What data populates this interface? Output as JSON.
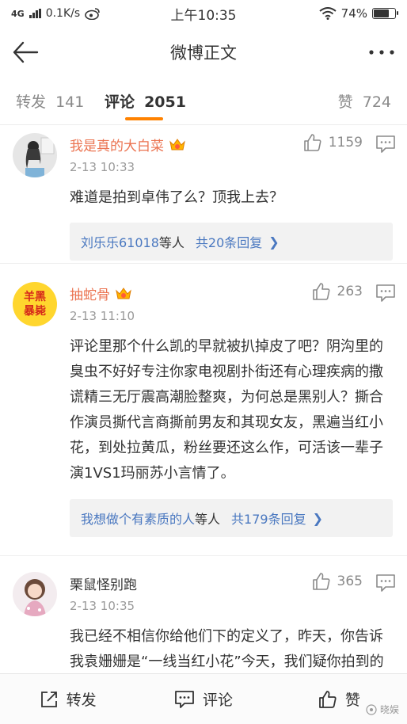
{
  "status_bar": {
    "network": "4G",
    "speed": "0.1K/s",
    "time": "上午10:35",
    "battery": "74%",
    "battery_level": 0.74
  },
  "nav": {
    "title": "微博正文"
  },
  "tabs": {
    "repost_label": "转发",
    "repost_count": "141",
    "comments_label": "评论",
    "comments_count": "2051",
    "likes_label": "赞",
    "likes_count": "724"
  },
  "comments": [
    {
      "username": "我是真的大白菜",
      "time": "2-13 10:33",
      "likes": "1159",
      "text": "难道是拍到卓伟了么？顶我上去？",
      "reply_who": "刘乐乐61018",
      "reply_mid": "等人",
      "reply_total": "共20条回复"
    },
    {
      "username": "抽蛇骨",
      "avatar_text_1": "羊黑",
      "avatar_text_2": "暴毙",
      "time": "2-13 11:10",
      "likes": "263",
      "text": "评论里那个什么凯的早就被扒掉皮了吧？阴沟里的臭虫不好好专注你家电视剧扑街还有心理疾病的撒谎精三无厅震高潮脸整爽，为何总是黑别人？撕合作演员撕代言商撕前男友和其现女友，黑遍当红小花，到处拉黄瓜，粉丝要还这么作，可活该一辈子演1VS1玛丽苏小言情了。",
      "reply_who": "我想做个有素质的人",
      "reply_mid": "等人",
      "reply_total": "共179条回复"
    },
    {
      "username": "栗鼠怪别跑",
      "time": "2-13 10:35",
      "likes": "365",
      "text": "我已经不相信你给他们下的定义了，昨天，你告诉我袁姗姗是“一线当红小花”今天，我们疑你拍到的到底是不是所谓的“男朋"
    }
  ],
  "bottom_bar": {
    "repost": "转发",
    "comment": "评论",
    "like": "赞"
  },
  "watermark": "晓娱"
}
